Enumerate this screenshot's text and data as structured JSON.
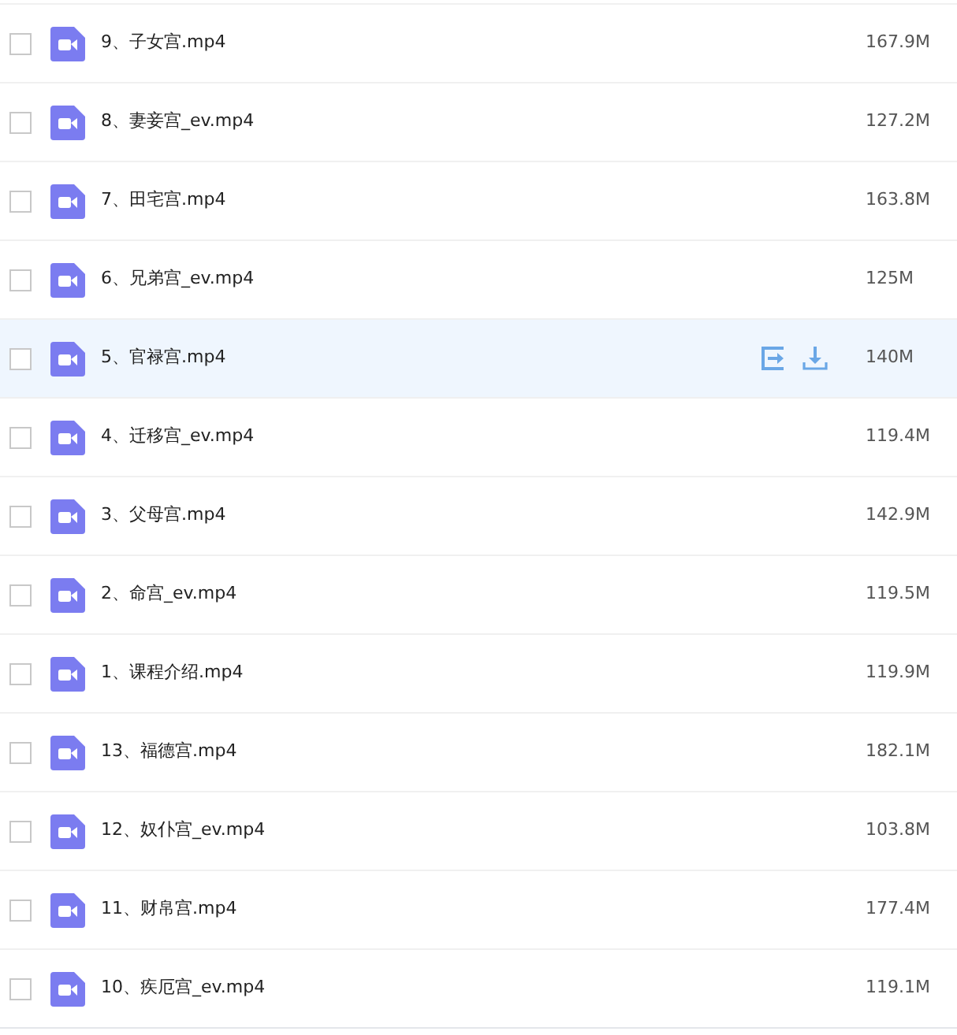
{
  "files": [
    {
      "name": "9、子女宫.mp4",
      "size": "167.9M",
      "checked": false,
      "hovered": false
    },
    {
      "name": "8、妻妾宫_ev.mp4",
      "size": "127.2M",
      "checked": false,
      "hovered": false
    },
    {
      "name": "7、田宅宫.mp4",
      "size": "163.8M",
      "checked": false,
      "hovered": false
    },
    {
      "name": "6、兄弟宫_ev.mp4",
      "size": "125M",
      "checked": false,
      "hovered": false
    },
    {
      "name": "5、官禄宫.mp4",
      "size": "140M",
      "checked": false,
      "hovered": true
    },
    {
      "name": "4、迁移宫_ev.mp4",
      "size": "119.4M",
      "checked": false,
      "hovered": false
    },
    {
      "name": "3、父母宫.mp4",
      "size": "142.9M",
      "checked": false,
      "hovered": false
    },
    {
      "name": "2、命宫_ev.mp4",
      "size": "119.5M",
      "checked": false,
      "hovered": false
    },
    {
      "name": "1、课程介绍.mp4",
      "size": "119.9M",
      "checked": false,
      "hovered": false
    },
    {
      "name": "13、福德宫.mp4",
      "size": "182.1M",
      "checked": false,
      "hovered": false
    },
    {
      "name": "12、奴仆宫_ev.mp4",
      "size": "103.8M",
      "checked": false,
      "hovered": false
    },
    {
      "name": "11、财帛宫.mp4",
      "size": "177.4M",
      "checked": false,
      "hovered": false
    },
    {
      "name": "10、疾厄宫_ev.mp4",
      "size": "119.1M",
      "checked": false,
      "hovered": false
    }
  ]
}
